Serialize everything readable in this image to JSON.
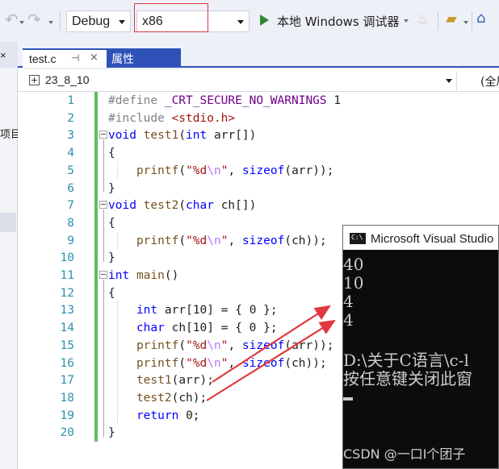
{
  "toolbar": {
    "config": "Debug",
    "platform": "x86",
    "run_label": "本地 Windows 调试器"
  },
  "left_panel": {
    "close_glyph": "×",
    "label": "项目"
  },
  "tabs": {
    "active": {
      "label": "test.c",
      "pin": "⊣",
      "close": "×"
    },
    "other": {
      "label": "属性"
    }
  },
  "navbar": {
    "project": "23_8_10",
    "scope": "(全局"
  },
  "editor": {
    "line_numbers": [
      "1",
      "2",
      "3",
      "4",
      "5",
      "6",
      "7",
      "8",
      "9",
      "10",
      "11",
      "12",
      "13",
      "14",
      "15",
      "16",
      "17",
      "18",
      "19",
      "20"
    ],
    "lines": [
      "#define _CRT_SECURE_NO_WARNINGS 1",
      "#include <stdio.h>",
      "void test1(int arr[])",
      "{",
      "    printf(\"%d\\n\", sizeof(arr));",
      "}",
      "void test2(char ch[])",
      "{",
      "    printf(\"%d\\n\", sizeof(ch));",
      "}",
      "int main()",
      "{",
      "    int arr[10] = { 0 };",
      "    char ch[10] = { 0 };",
      "    printf(\"%d\\n\", sizeof(arr));",
      "    printf(\"%d\\n\", sizeof(ch));",
      "    test1(arr);",
      "    test2(ch);",
      "    return 0;",
      "}"
    ]
  },
  "console": {
    "title": "Microsoft Visual Studio",
    "icon_text": "C:\\",
    "output": [
      "40",
      "10",
      "4",
      "4",
      "",
      "D:\\关于C语言\\c-l",
      "按任意键关闭此窗"
    ],
    "watermark": "CSDN @一口I个团子"
  },
  "colors": {
    "accent": "#2f52b8",
    "annotation_red": "#e0383e",
    "gutter_green": "#5fbd5f"
  }
}
